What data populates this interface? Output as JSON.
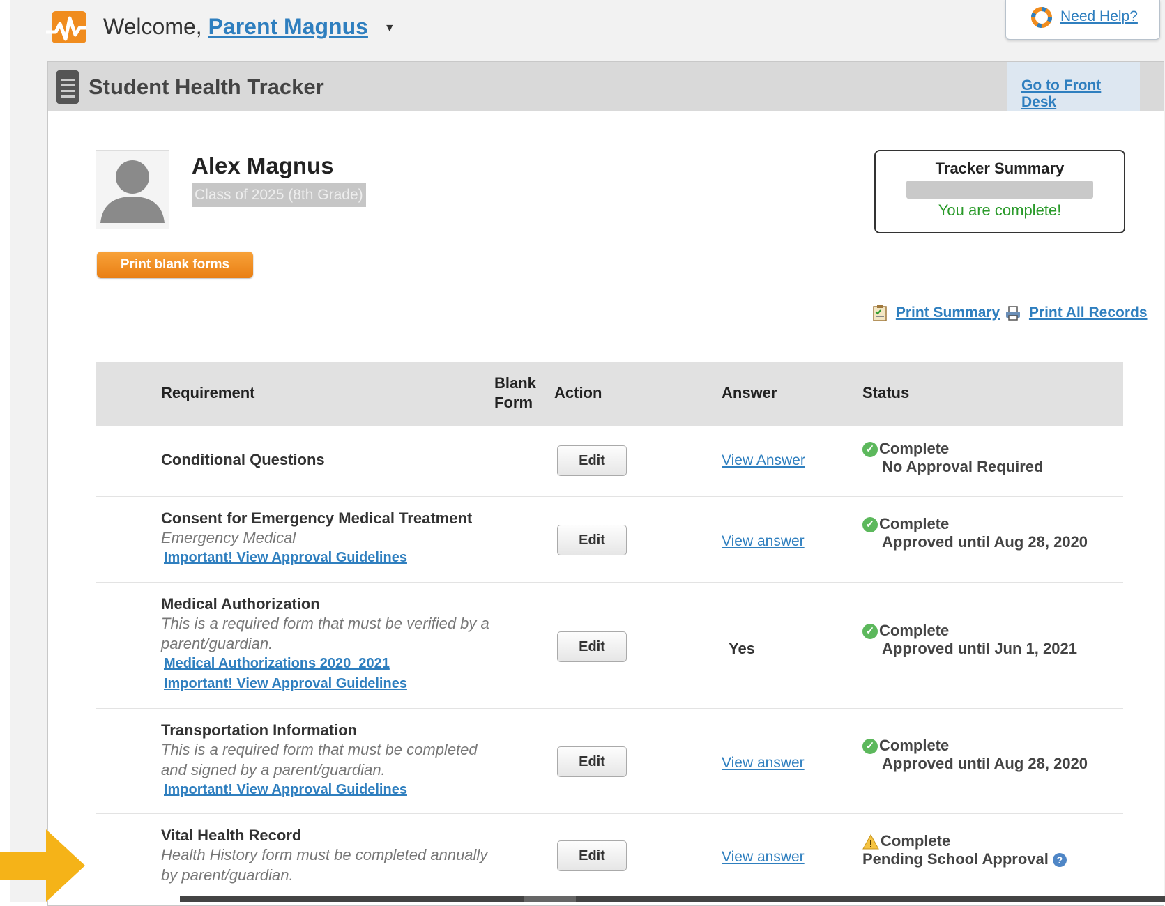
{
  "header": {
    "welcome_prefix": "Welcome,",
    "user_name": "Parent Magnus",
    "help_label": "Need Help?"
  },
  "panel": {
    "title": "Student Health Tracker",
    "front_desk_label": "Go to Front Desk"
  },
  "student": {
    "name": "Alex Magnus",
    "class_label": "Class of 2025 (8th Grade)"
  },
  "print_blank_label": "Print blank forms",
  "tracker_summary": {
    "title": "Tracker Summary",
    "message": "You are complete!"
  },
  "print_links": {
    "summary": "Print Summary",
    "all_records": "Print All Records"
  },
  "table": {
    "headers": {
      "requirement": "Requirement",
      "blank_form_1": "Blank",
      "blank_form_2": "Form",
      "action": "Action",
      "answer": "Answer",
      "status": "Status"
    },
    "rows": [
      {
        "title": "Conditional Questions",
        "action": "Edit",
        "answer_link": "View Answer",
        "status": "Complete",
        "status_detail": "No Approval Required"
      },
      {
        "title": "Consent for Emergency Medical Treatment",
        "subtitle": "Emergency Medical",
        "link1": "Important! View Approval Guidelines",
        "action": "Edit",
        "answer_link": "View answer",
        "status": "Complete",
        "status_detail": "Approved until Aug 28, 2020"
      },
      {
        "title": "Medical Authorization",
        "subtitle1": "This is a required form that must be verified by a",
        "subtitle2": "parent/guardian.",
        "link1": "Medical Authorizations 2020_2021",
        "link2": "Important! View Approval Guidelines",
        "action": "Edit",
        "answer_text": "Yes",
        "status": "Complete",
        "status_detail": "Approved until Jun 1, 2021"
      },
      {
        "title": "Transportation Information",
        "subtitle1": "This is a required form that must be completed",
        "subtitle2": "and signed by a parent/guardian.",
        "link1": "Important! View Approval Guidelines",
        "action": "Edit",
        "answer_link": "View answer",
        "status": "Complete",
        "status_detail": "Approved until Aug 28, 2020"
      },
      {
        "title": "Vital Health Record",
        "subtitle1": "Health History form must be completed annually",
        "subtitle2": "by parent/guardian.",
        "action": "Edit",
        "answer_link": "View answer",
        "status": "Complete",
        "status_detail": "Pending School Approval"
      }
    ]
  },
  "colors": {
    "link": "#2f7fbf",
    "accent_orange": "#f08c1e",
    "success_green": "#5cb85c",
    "header_gray": "#d9d9d9"
  }
}
